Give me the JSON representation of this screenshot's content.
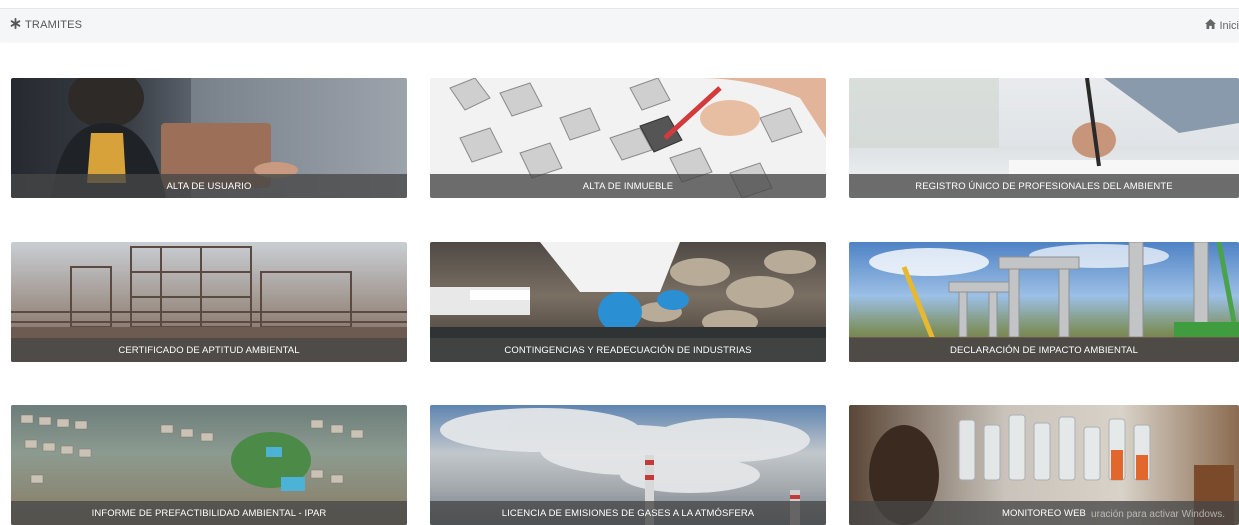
{
  "header": {
    "title": "TRAMITES",
    "home_label": "Inici",
    "icons": {
      "title": "asterisk-icon",
      "home": "home-icon"
    }
  },
  "cards": [
    {
      "label": "ALTA DE USUARIO"
    },
    {
      "label": "ALTA DE INMUEBLE"
    },
    {
      "label": "REGISTRO ÚNICO DE PROFESIONALES DEL AMBIENTE"
    },
    {
      "label": "CERTIFICADO DE APTITUD AMBIENTAL"
    },
    {
      "label": "CONTINGENCIAS Y READECUACIÓN DE INDUSTRIAS"
    },
    {
      "label": "DECLARACIÓN DE IMPACTO AMBIENTAL"
    },
    {
      "label": "INFORME DE PREFACTIBILIDAD AMBIENTAL - IPAR"
    },
    {
      "label": "LICENCIA DE EMISIONES DE GASES A LA ATMÓSFERA"
    },
    {
      "label": "MONITOREO WEB"
    }
  ],
  "watermark": "uración para activar Windows."
}
